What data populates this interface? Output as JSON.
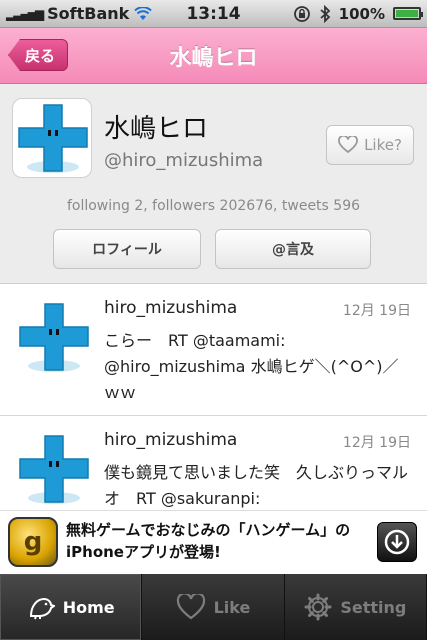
{
  "status": {
    "carrier": "SoftBank",
    "time": "13:14",
    "battery": "100%",
    "battery_level": 1.0
  },
  "nav": {
    "back_label": "戻る",
    "title": "水嶋ヒロ"
  },
  "profile": {
    "name": "水嶋ヒロ",
    "handle": "@hiro_mizushima",
    "like_label": "Like?",
    "stats": "following 2, followers 202676, tweets 596",
    "profile_button": "ロフィール",
    "mention_button": "@言及"
  },
  "tweets": [
    {
      "user": "hiro_mizushima",
      "date": "12月 19日",
      "text": "こらー　RT @taamami: @hiro_mizushima 水嶋ヒゲ＼(^O^)／ｗｗ"
    },
    {
      "user": "hiro_mizushima",
      "date": "12月 19日",
      "text": "僕も鏡見て思いました笑　久しぶりっマルオ　RT @sakuranpi:"
    }
  ],
  "ad": {
    "icon_letter": "g",
    "text": "無料ゲームでおなじみの「ハンゲーム」のiPhoneアプリが登場!"
  },
  "tabs": [
    {
      "label": "Home",
      "icon": "bird-icon",
      "active": true
    },
    {
      "label": "Like",
      "icon": "heart-icon",
      "active": false
    },
    {
      "label": "Setting",
      "icon": "gear-icon",
      "active": false
    }
  ],
  "colors": {
    "nav_pink": "#f58ab8",
    "back_button": "#c6326f",
    "avatar_blue": "#1e9ad6",
    "tab_bar": "#1b1b1b"
  }
}
